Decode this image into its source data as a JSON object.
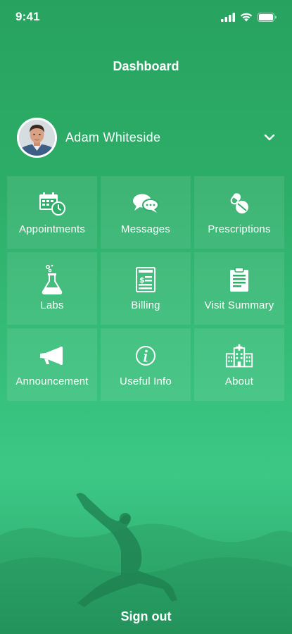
{
  "status_bar": {
    "time": "9:41",
    "icons": [
      "signal-icon",
      "wifi-icon",
      "battery-icon"
    ]
  },
  "header": {
    "title": "Dashboard"
  },
  "profile": {
    "name": "Adam Whiteside",
    "icon": "chevron-down-icon"
  },
  "tiles": [
    {
      "label": "Appointments",
      "icon": "calendar-clock-icon"
    },
    {
      "label": "Messages",
      "icon": "chat-bubbles-icon"
    },
    {
      "label": "Prescriptions",
      "icon": "pills-icon"
    },
    {
      "label": "Labs",
      "icon": "flask-icon"
    },
    {
      "label": "Billing",
      "icon": "invoice-icon"
    },
    {
      "label": "Visit Summary",
      "icon": "clipboard-icon"
    },
    {
      "label": "Announcement",
      "icon": "megaphone-icon"
    },
    {
      "label": "Useful Info",
      "icon": "info-icon"
    },
    {
      "label": "About",
      "icon": "hospital-icon"
    }
  ],
  "footer": {
    "signout_label": "Sign out"
  },
  "colors": {
    "background": "#2dae68",
    "text": "#ffffff"
  }
}
